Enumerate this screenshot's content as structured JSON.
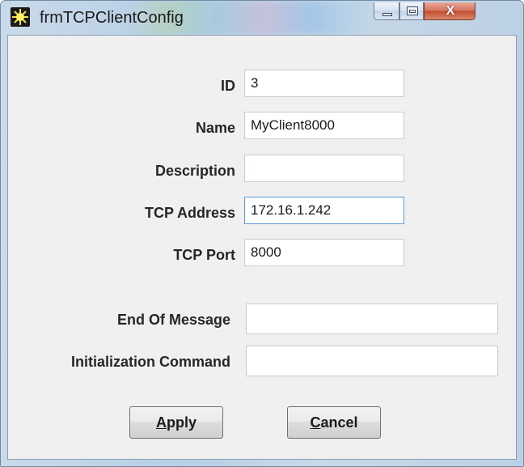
{
  "window": {
    "title": "frmTCPClientConfig",
    "icon": "app-sun-icon",
    "controls": {
      "minimize": "minimize-icon",
      "maximize": "maximize-icon",
      "close": "X"
    }
  },
  "form": {
    "id": {
      "label": "ID",
      "value": "3"
    },
    "name": {
      "label": "Name",
      "value": "MyClient8000"
    },
    "description": {
      "label": "Description",
      "value": ""
    },
    "tcp_address": {
      "label": "TCP Address",
      "value": "172.16.1.242"
    },
    "tcp_port": {
      "label": "TCP Port",
      "value": "8000"
    },
    "end_of_message": {
      "label": "End Of Message",
      "value": ""
    },
    "init_command": {
      "label": "Initialization Command",
      "value": ""
    }
  },
  "buttons": {
    "apply": {
      "mnemonic": "A",
      "rest": "pply"
    },
    "cancel": {
      "mnemonic": "C",
      "rest": "ancel"
    }
  },
  "colors": {
    "focus_border": "#5b9bd1",
    "close_button": "#c34a2e"
  }
}
